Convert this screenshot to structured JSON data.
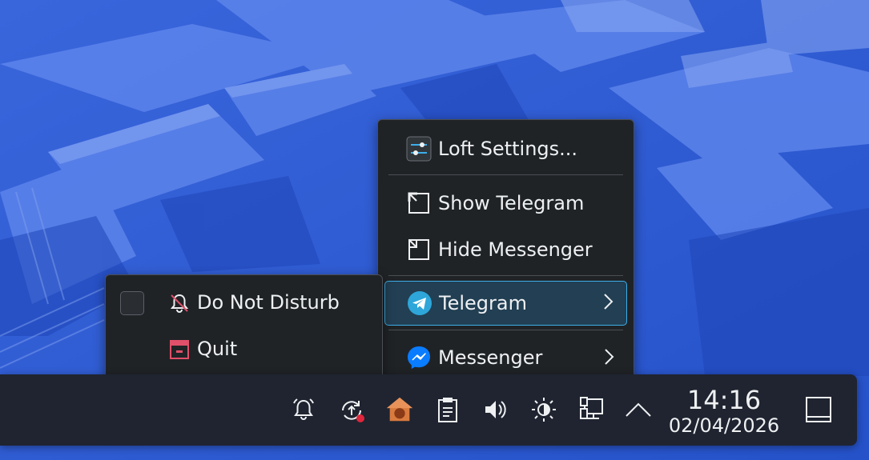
{
  "menu": {
    "items": [
      {
        "label": "Loft Settings...",
        "icon": "settings-sliders-icon"
      },
      {
        "label": "Show Telegram",
        "icon": "window-restore-icon"
      },
      {
        "label": "Hide Messenger",
        "icon": "window-minimize-icon"
      },
      {
        "label": "Telegram",
        "icon": "telegram-icon",
        "has_submenu": true,
        "active": true
      },
      {
        "label": "Messenger",
        "icon": "messenger-icon",
        "has_submenu": true
      }
    ]
  },
  "submenu": {
    "items": [
      {
        "label": "Do Not Disturb",
        "icon": "bell-off-icon",
        "checked": false
      },
      {
        "label": "Quit",
        "icon": "quit-icon"
      }
    ]
  },
  "taskbar": {
    "clock": {
      "time": "14:16",
      "date": "02/04/2026"
    },
    "tray_icons": [
      "notifications-icon",
      "update-icon",
      "home-app-icon",
      "clipboard-icon",
      "volume-icon",
      "brightness-icon",
      "network-icon",
      "expand-tray-icon",
      "show-desktop-icon"
    ]
  },
  "colors": {
    "accent": "#3daee9",
    "menu_bg": "#202326",
    "panel_bg": "#1f2430",
    "telegram": "#2ea6d9",
    "messenger": "#0a7cff",
    "quit": "#e0506a"
  }
}
